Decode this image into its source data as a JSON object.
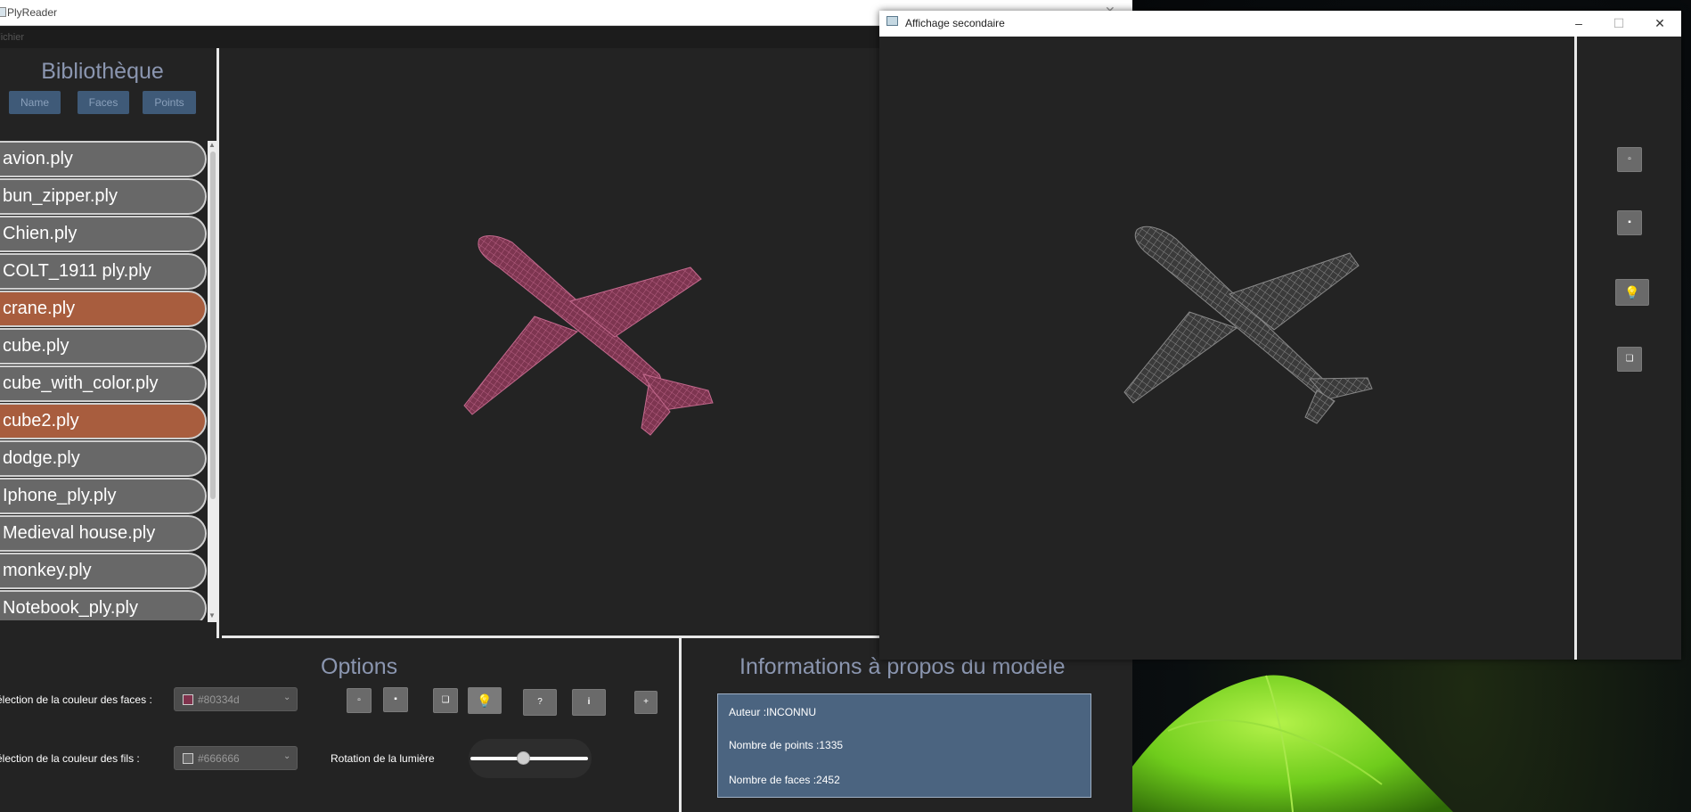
{
  "main_window": {
    "title": "PlyReader",
    "menu": [
      "Fichier"
    ]
  },
  "library": {
    "heading": "Bibliothèque",
    "sort_buttons": [
      "Name",
      "Faces",
      "Points"
    ],
    "files": [
      {
        "name": "avion.ply",
        "selected": false
      },
      {
        "name": "bun_zipper.ply",
        "selected": false
      },
      {
        "name": "Chien.ply",
        "selected": false
      },
      {
        "name": "COLT_1911 ply.ply",
        "selected": false
      },
      {
        "name": "crane.ply",
        "selected": true
      },
      {
        "name": "cube.ply",
        "selected": false
      },
      {
        "name": "cube_with_color.ply",
        "selected": false
      },
      {
        "name": "cube2.ply",
        "selected": true
      },
      {
        "name": "dodge.ply",
        "selected": false
      },
      {
        "name": "Iphone_ply.ply",
        "selected": false
      },
      {
        "name": "Medieval house.ply",
        "selected": false
      },
      {
        "name": "monkey.ply",
        "selected": false
      },
      {
        "name": "Notebook_ply.ply",
        "selected": false
      }
    ]
  },
  "options": {
    "heading": "Options",
    "face_color_label": "élection de la couleur des faces :",
    "face_color_value": "#80334d",
    "wire_color_label": "élection de la couleur des fils :",
    "wire_color_value": "#666666",
    "light_rotation_label": "Rotation de la lumière",
    "light_rotation_fraction": 0.45,
    "toolbar_buttons": [
      {
        "icon": "square-outline-icon",
        "glyph": "▫"
      },
      {
        "icon": "square-filled-icon",
        "glyph": "▪"
      },
      {
        "icon": "double-square-icon",
        "glyph": "❏"
      },
      {
        "icon": "lightbulb-icon",
        "glyph": "💡"
      },
      {
        "icon": "question-icon",
        "glyph": "?"
      },
      {
        "icon": "info-icon",
        "glyph": "i"
      },
      {
        "icon": "plus-icon",
        "glyph": "+"
      }
    ]
  },
  "model_info": {
    "heading": "Informations à propos du modèle",
    "author": "Auteur :INCONNU",
    "points": "Nombre de points :1335",
    "faces": "Nombre de faces :2452"
  },
  "secondary_window": {
    "title": "Affichage secondaire",
    "controls": [
      "–",
      "☐",
      "✕"
    ],
    "toolbar_buttons": [
      {
        "icon": "square-outline-icon",
        "glyph": "▫"
      },
      {
        "icon": "square-filled-icon",
        "glyph": "▪"
      },
      {
        "icon": "lightbulb-icon",
        "glyph": "💡"
      },
      {
        "icon": "double-square-icon",
        "glyph": "❏"
      }
    ]
  },
  "colors": {
    "face": "#80334d",
    "wire_pink": "#c46a8e",
    "wire_gray": "#666666",
    "selected_item": "#a85d3e",
    "tent": "#7bd325"
  }
}
